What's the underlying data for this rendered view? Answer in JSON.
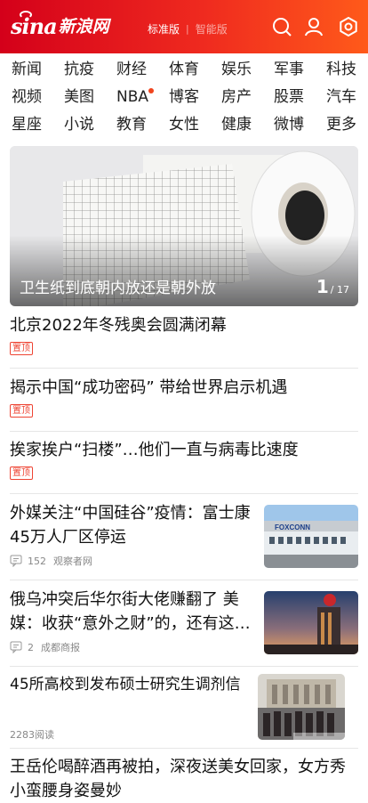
{
  "header": {
    "logo_latin": "sina",
    "logo_cn": "新浪网",
    "modes": [
      "标准版",
      "智能版"
    ],
    "icons": [
      "search-icon",
      "user-icon",
      "settings-icon"
    ]
  },
  "channels": [
    [
      "新闻",
      "抗疫",
      "财经",
      "体育",
      "娱乐",
      "军事",
      "科技"
    ],
    [
      "视频",
      "美图",
      "NBA",
      "博客",
      "房产",
      "股票",
      "汽车"
    ],
    [
      "星座",
      "小说",
      "教育",
      "女性",
      "健康",
      "微博",
      "更多"
    ]
  ],
  "hero": {
    "caption": "卫生纸到底朝内放还是朝外放",
    "current": "1",
    "total": "/ 17"
  },
  "pinned": [
    {
      "title": "北京2022年冬残奥会圆满闭幕",
      "badge": "置顶"
    },
    {
      "title": "揭示中国“成功密码” 带给世界启示机遇",
      "badge": "置顶"
    },
    {
      "title": "挨家挨户“扫楼”…他们一直与病毒比速度",
      "badge": "置顶"
    }
  ],
  "stories": [
    {
      "title": "外媒关注“中国硅谷”疫情：富士康45万人厂区停运",
      "comments": "152",
      "source": "观察者网",
      "thumb_text": "FOXCONN"
    },
    {
      "title": "俄乌冲突后华尔街大佬赚翻了 美媒：收获“意外之财”的，还有这…",
      "comments": "2",
      "source": "成都商报"
    },
    {
      "title": "45所高校到发布硕士研究生调剂信",
      "reads": "2283阅读"
    },
    {
      "title": "王岳伦喝醉酒再被拍，深夜送美女回家，女方秀小蛮腰身姿曼妙"
    }
  ],
  "colors": {
    "header_start": "#d4001a",
    "header_end": "#ff5a1a",
    "badge": "#ee4433",
    "nav_dot": "#f0441d"
  }
}
